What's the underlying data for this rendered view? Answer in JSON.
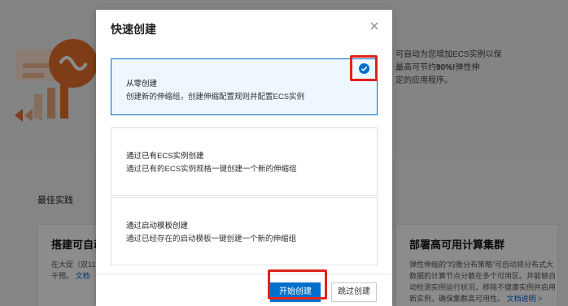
{
  "background": {
    "intro_line1": "可自动为您增加ECS实例以保",
    "intro_line2_prefix": "最高可节约",
    "intro_line2_bold": "90%!",
    "intro_line2_suffix": "弹性伸",
    "intro_line3": "定的应用程序。",
    "section_title": "最佳实践",
    "card1_title": "搭建可自动",
    "card1_text": "在大促（双11间量激增且峰可自动快速架工干预。",
    "card1_link": "文档",
    "card2_title": "部署高可用计算集群",
    "card2_text": "弹性伸缩的“均衡分布策略”可自动将分布式大数据的计算节点分散在多个可用区。并能够自动检测实例运行状况，移除不健康实例并启用新实例，确保集群高可用性。",
    "card2_link": "文档说明 >"
  },
  "modal": {
    "title": "快速创建",
    "options": [
      {
        "title": "从零创建",
        "desc": "创建新的伸缩组，创建伸缩配置规则并配置ECS实例",
        "selected": true
      },
      {
        "title": "通过已有ECS实例创建",
        "desc": "通过已有的ECS实例规格一键创建一个新的伸缩组",
        "selected": false
      },
      {
        "title": "通过启动模板创建",
        "desc": "通过已经存在的启动模板一键创建一个新的伸缩组",
        "selected": false
      }
    ],
    "primary_button": "开始创建",
    "secondary_button": "跳过创建"
  },
  "colors": {
    "accent": "#0070cc",
    "highlight_box": "#e2231a",
    "illustration": "#e8702a"
  },
  "icons": [
    "close-icon",
    "check-circle-icon",
    "scaling-logo-icon"
  ]
}
